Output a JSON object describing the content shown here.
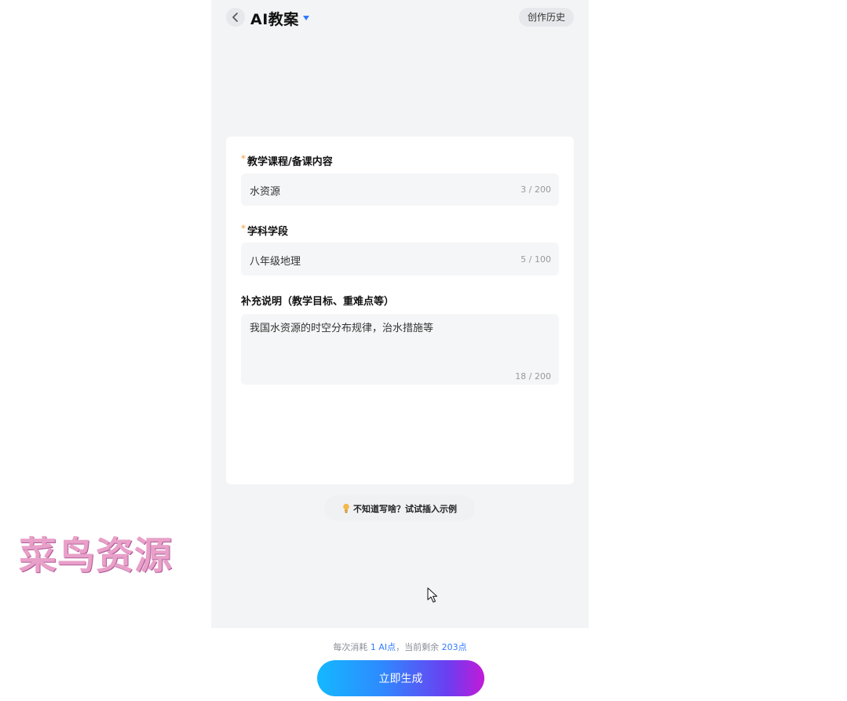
{
  "header": {
    "title": "AI教案",
    "history_label": "创作历史"
  },
  "form": {
    "fields": [
      {
        "label": "教学课程/备课内容",
        "required": true,
        "value": "水资源",
        "counter": "3 / 200"
      },
      {
        "label": "学科学段",
        "required": true,
        "value": "八年级地理",
        "counter": "5 / 100"
      },
      {
        "label": "补充说明（教学目标、重难点等）",
        "required": false,
        "value": "我国水资源的时空分布规律，治水措施等",
        "counter": "18 / 200"
      }
    ],
    "required_mark": "*"
  },
  "tip": {
    "text": "不知道写啥？试试插入示例"
  },
  "footer": {
    "cost_prefix": "每次消耗 ",
    "cost_points": "1 AI点",
    "cost_middle": "，当前剩余 ",
    "remaining_points": "203点",
    "generate_label": "立即生成"
  },
  "watermark": "菜鸟资源",
  "colors": {
    "accent": "#2f7bff",
    "required": "#f0a04b",
    "gradient_start": "#14b8ff",
    "gradient_end": "#c21ad8"
  },
  "icons": [
    "chevron-left-icon",
    "caret-down-icon",
    "lightbulb-icon",
    "cursor-pointer-icon"
  ]
}
